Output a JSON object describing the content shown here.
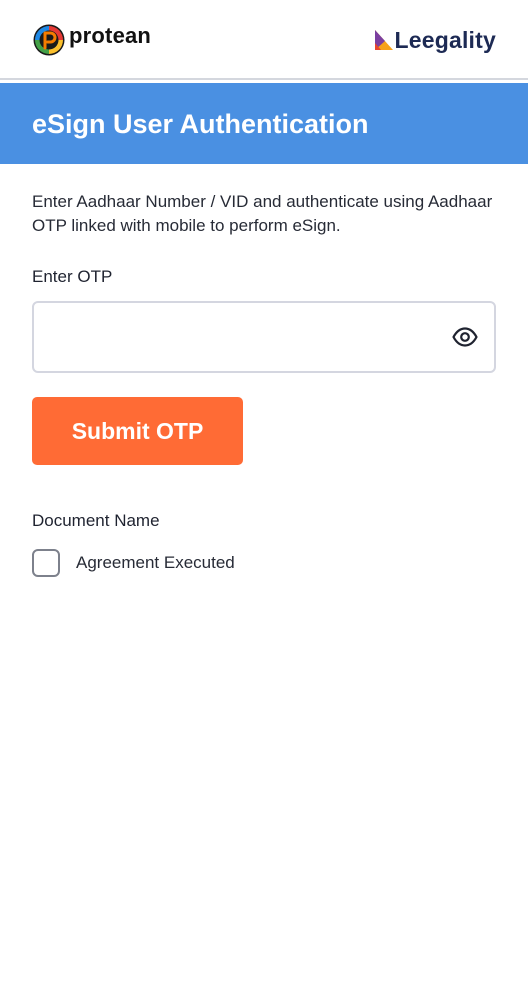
{
  "brands": {
    "left_name": "protean",
    "right_name": "Leegality"
  },
  "header": {
    "title": "eSign User Authentication"
  },
  "main": {
    "description": "Enter Aadhaar Number / VID and authenticate using Aadhaar OTP linked with mobile to perform eSign.",
    "otp": {
      "label": "Enter OTP",
      "value": "",
      "toggle_icon": "eye-icon"
    },
    "submit_label": "Submit OTP",
    "documents": {
      "label": "Document Name",
      "items": [
        {
          "label": "Agreement Executed",
          "checked": false
        }
      ]
    }
  },
  "colors": {
    "header_bg": "#4a90e2",
    "primary_button": "#ff6b35",
    "brand_text_right": "#1d2a54"
  }
}
